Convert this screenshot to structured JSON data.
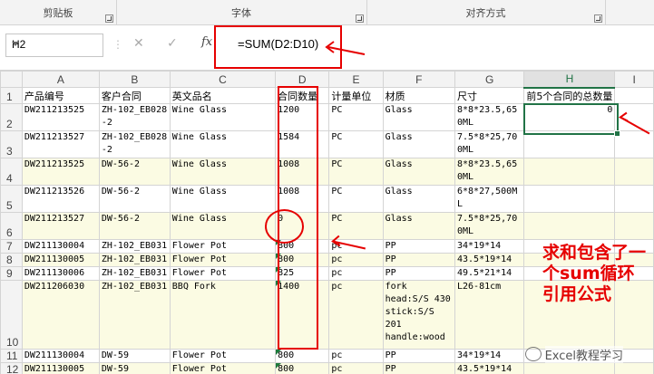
{
  "ribbon": {
    "groups": [
      {
        "label": "剪贴板"
      },
      {
        "label": "字体"
      },
      {
        "label": "对齐方式"
      }
    ]
  },
  "formula_bar": {
    "name_box": "H2",
    "fx_label": "fx",
    "formula": "=SUM(D2:D10)"
  },
  "columns": [
    "A",
    "B",
    "C",
    "D",
    "E",
    "F",
    "G",
    "H",
    "I"
  ],
  "selected_column": "H",
  "rows": [
    {
      "n": "1",
      "cells": [
        "产品编号",
        "客户合同",
        "英文品名",
        "合同数量",
        "计量单位",
        "材质",
        "尺寸",
        "前5个合同的总数量",
        ""
      ]
    },
    {
      "n": "2",
      "cells": [
        "DW211213525",
        "ZH-102_EB028-2",
        "Wine Glass",
        "1200",
        "PC",
        "Glass",
        "8*8*23.5,650ML",
        "0",
        ""
      ]
    },
    {
      "n": "3",
      "cells": [
        "DW211213527",
        "ZH-102_EB028-2",
        "Wine Glass",
        "1584",
        "PC",
        "Glass",
        "7.5*8*25,700ML",
        "",
        ""
      ]
    },
    {
      "n": "4",
      "cells": [
        "DW211213525",
        "DW-56-2",
        "Wine Glass",
        "1008",
        "PC",
        "Glass",
        "8*8*23.5,650ML",
        "",
        ""
      ]
    },
    {
      "n": "5",
      "cells": [
        "DW211213526",
        "DW-56-2",
        "Wine Glass",
        "1008",
        "PC",
        "Glass",
        "6*8*27,500ML",
        "",
        ""
      ]
    },
    {
      "n": "6",
      "cells": [
        "DW211213527",
        "DW-56-2",
        "Wine Glass",
        "0",
        "PC",
        "Glass",
        "7.5*8*25,700ML",
        "",
        ""
      ]
    },
    {
      "n": "7",
      "cells": [
        "DW211130004",
        "ZH-102_EB031",
        "Flower Pot",
        "800",
        "pc",
        "PP",
        "34*19*14",
        "",
        ""
      ]
    },
    {
      "n": "8",
      "cells": [
        "DW211130005",
        "ZH-102_EB031",
        "Flower Pot",
        "800",
        "pc",
        "PP",
        "43.5*19*14",
        "",
        ""
      ]
    },
    {
      "n": "9",
      "cells": [
        "DW211130006",
        "ZH-102_EB031",
        "Flower Pot",
        "825",
        "pc",
        "PP",
        "49.5*21*14",
        "",
        ""
      ]
    },
    {
      "n": "10",
      "cells": [
        "DW211206030",
        "ZH-102_EB031",
        "BBQ Fork",
        "1400",
        "pc",
        "fork head:S/S 430 stick:S/S 201 handle:wood",
        "L26-81cm",
        "",
        ""
      ]
    },
    {
      "n": "11",
      "cells": [
        "DW211130004",
        "DW-59",
        "Flower Pot",
        "800",
        "pc",
        "PP",
        "34*19*14",
        "",
        ""
      ]
    },
    {
      "n": "12",
      "cells": [
        "DW211130005",
        "DW-59",
        "Flower Pot",
        "800",
        "pc",
        "PP",
        "43.5*19*14",
        "",
        ""
      ]
    }
  ],
  "annotation": {
    "text": "求和包含了一个sum循环引用公式",
    "color": "#e60000"
  },
  "watermark": "Excel教程学习",
  "colors": {
    "accent": "#217346",
    "highlight_row": "#fbfbe3",
    "annotation_red": "#e60000"
  }
}
